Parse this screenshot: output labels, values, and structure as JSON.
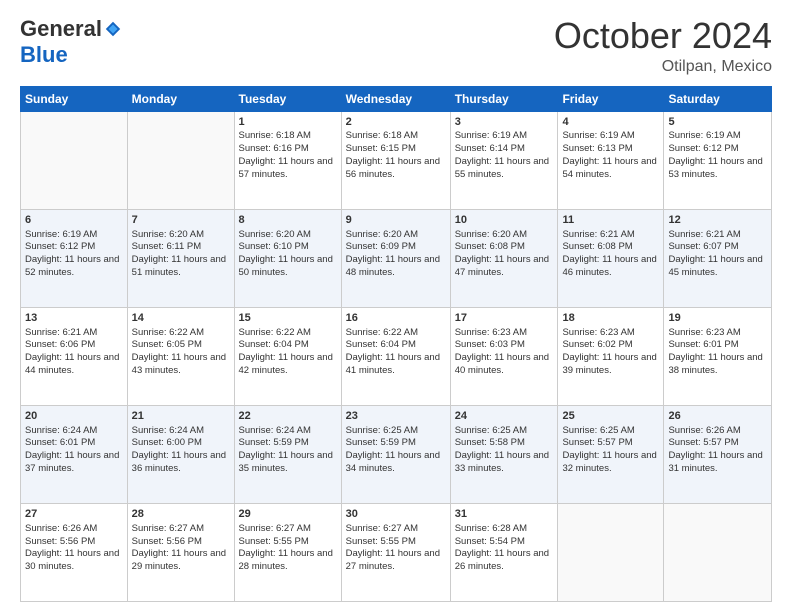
{
  "header": {
    "logo_general": "General",
    "logo_blue": "Blue",
    "month_title": "October 2024",
    "location": "Otilpan, Mexico"
  },
  "columns": [
    "Sunday",
    "Monday",
    "Tuesday",
    "Wednesday",
    "Thursday",
    "Friday",
    "Saturday"
  ],
  "weeks": [
    [
      {
        "day": "",
        "info": ""
      },
      {
        "day": "",
        "info": ""
      },
      {
        "day": "1",
        "sunrise": "Sunrise: 6:18 AM",
        "sunset": "Sunset: 6:16 PM",
        "daylight": "Daylight: 11 hours and 57 minutes."
      },
      {
        "day": "2",
        "sunrise": "Sunrise: 6:18 AM",
        "sunset": "Sunset: 6:15 PM",
        "daylight": "Daylight: 11 hours and 56 minutes."
      },
      {
        "day": "3",
        "sunrise": "Sunrise: 6:19 AM",
        "sunset": "Sunset: 6:14 PM",
        "daylight": "Daylight: 11 hours and 55 minutes."
      },
      {
        "day": "4",
        "sunrise": "Sunrise: 6:19 AM",
        "sunset": "Sunset: 6:13 PM",
        "daylight": "Daylight: 11 hours and 54 minutes."
      },
      {
        "day": "5",
        "sunrise": "Sunrise: 6:19 AM",
        "sunset": "Sunset: 6:12 PM",
        "daylight": "Daylight: 11 hours and 53 minutes."
      }
    ],
    [
      {
        "day": "6",
        "sunrise": "Sunrise: 6:19 AM",
        "sunset": "Sunset: 6:12 PM",
        "daylight": "Daylight: 11 hours and 52 minutes."
      },
      {
        "day": "7",
        "sunrise": "Sunrise: 6:20 AM",
        "sunset": "Sunset: 6:11 PM",
        "daylight": "Daylight: 11 hours and 51 minutes."
      },
      {
        "day": "8",
        "sunrise": "Sunrise: 6:20 AM",
        "sunset": "Sunset: 6:10 PM",
        "daylight": "Daylight: 11 hours and 50 minutes."
      },
      {
        "day": "9",
        "sunrise": "Sunrise: 6:20 AM",
        "sunset": "Sunset: 6:09 PM",
        "daylight": "Daylight: 11 hours and 48 minutes."
      },
      {
        "day": "10",
        "sunrise": "Sunrise: 6:20 AM",
        "sunset": "Sunset: 6:08 PM",
        "daylight": "Daylight: 11 hours and 47 minutes."
      },
      {
        "day": "11",
        "sunrise": "Sunrise: 6:21 AM",
        "sunset": "Sunset: 6:08 PM",
        "daylight": "Daylight: 11 hours and 46 minutes."
      },
      {
        "day": "12",
        "sunrise": "Sunrise: 6:21 AM",
        "sunset": "Sunset: 6:07 PM",
        "daylight": "Daylight: 11 hours and 45 minutes."
      }
    ],
    [
      {
        "day": "13",
        "sunrise": "Sunrise: 6:21 AM",
        "sunset": "Sunset: 6:06 PM",
        "daylight": "Daylight: 11 hours and 44 minutes."
      },
      {
        "day": "14",
        "sunrise": "Sunrise: 6:22 AM",
        "sunset": "Sunset: 6:05 PM",
        "daylight": "Daylight: 11 hours and 43 minutes."
      },
      {
        "day": "15",
        "sunrise": "Sunrise: 6:22 AM",
        "sunset": "Sunset: 6:04 PM",
        "daylight": "Daylight: 11 hours and 42 minutes."
      },
      {
        "day": "16",
        "sunrise": "Sunrise: 6:22 AM",
        "sunset": "Sunset: 6:04 PM",
        "daylight": "Daylight: 11 hours and 41 minutes."
      },
      {
        "day": "17",
        "sunrise": "Sunrise: 6:23 AM",
        "sunset": "Sunset: 6:03 PM",
        "daylight": "Daylight: 11 hours and 40 minutes."
      },
      {
        "day": "18",
        "sunrise": "Sunrise: 6:23 AM",
        "sunset": "Sunset: 6:02 PM",
        "daylight": "Daylight: 11 hours and 39 minutes."
      },
      {
        "day": "19",
        "sunrise": "Sunrise: 6:23 AM",
        "sunset": "Sunset: 6:01 PM",
        "daylight": "Daylight: 11 hours and 38 minutes."
      }
    ],
    [
      {
        "day": "20",
        "sunrise": "Sunrise: 6:24 AM",
        "sunset": "Sunset: 6:01 PM",
        "daylight": "Daylight: 11 hours and 37 minutes."
      },
      {
        "day": "21",
        "sunrise": "Sunrise: 6:24 AM",
        "sunset": "Sunset: 6:00 PM",
        "daylight": "Daylight: 11 hours and 36 minutes."
      },
      {
        "day": "22",
        "sunrise": "Sunrise: 6:24 AM",
        "sunset": "Sunset: 5:59 PM",
        "daylight": "Daylight: 11 hours and 35 minutes."
      },
      {
        "day": "23",
        "sunrise": "Sunrise: 6:25 AM",
        "sunset": "Sunset: 5:59 PM",
        "daylight": "Daylight: 11 hours and 34 minutes."
      },
      {
        "day": "24",
        "sunrise": "Sunrise: 6:25 AM",
        "sunset": "Sunset: 5:58 PM",
        "daylight": "Daylight: 11 hours and 33 minutes."
      },
      {
        "day": "25",
        "sunrise": "Sunrise: 6:25 AM",
        "sunset": "Sunset: 5:57 PM",
        "daylight": "Daylight: 11 hours and 32 minutes."
      },
      {
        "day": "26",
        "sunrise": "Sunrise: 6:26 AM",
        "sunset": "Sunset: 5:57 PM",
        "daylight": "Daylight: 11 hours and 31 minutes."
      }
    ],
    [
      {
        "day": "27",
        "sunrise": "Sunrise: 6:26 AM",
        "sunset": "Sunset: 5:56 PM",
        "daylight": "Daylight: 11 hours and 30 minutes."
      },
      {
        "day": "28",
        "sunrise": "Sunrise: 6:27 AM",
        "sunset": "Sunset: 5:56 PM",
        "daylight": "Daylight: 11 hours and 29 minutes."
      },
      {
        "day": "29",
        "sunrise": "Sunrise: 6:27 AM",
        "sunset": "Sunset: 5:55 PM",
        "daylight": "Daylight: 11 hours and 28 minutes."
      },
      {
        "day": "30",
        "sunrise": "Sunrise: 6:27 AM",
        "sunset": "Sunset: 5:55 PM",
        "daylight": "Daylight: 11 hours and 27 minutes."
      },
      {
        "day": "31",
        "sunrise": "Sunrise: 6:28 AM",
        "sunset": "Sunset: 5:54 PM",
        "daylight": "Daylight: 11 hours and 26 minutes."
      },
      {
        "day": "",
        "info": ""
      },
      {
        "day": "",
        "info": ""
      }
    ]
  ]
}
